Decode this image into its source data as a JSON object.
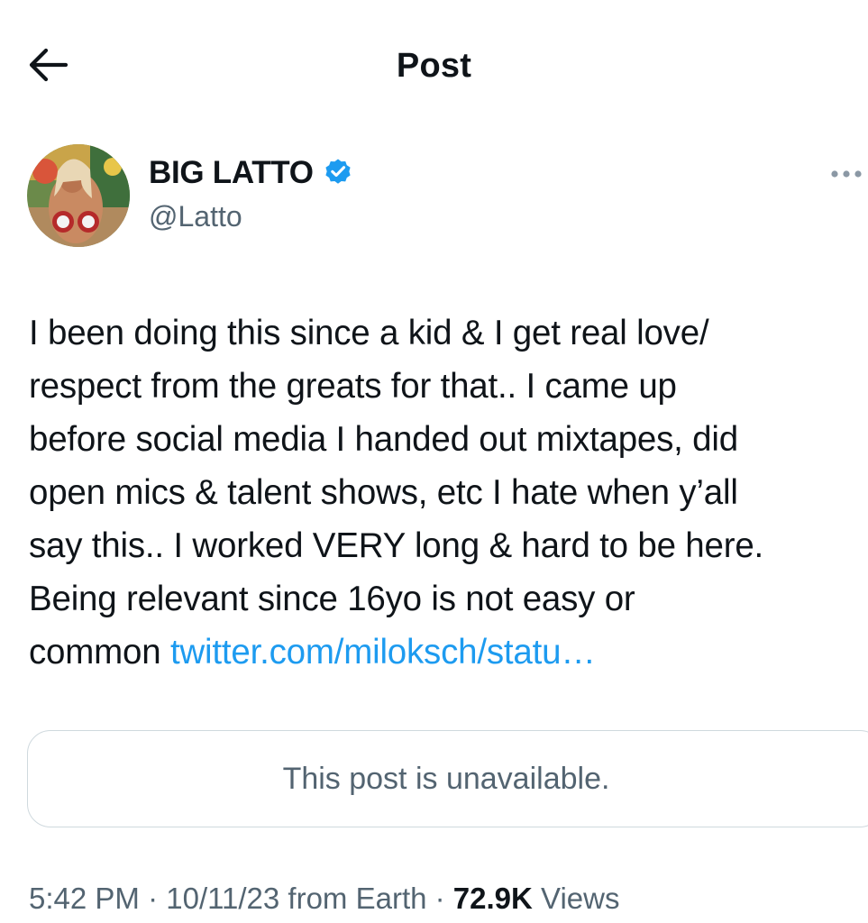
{
  "header": {
    "title": "Post",
    "back_icon": "arrow-left-icon"
  },
  "author": {
    "display_name": "BIG LATTO",
    "handle": "@Latto",
    "verified_icon": "verified-badge-icon",
    "verified_color": "#1d9bf0",
    "more_icon": "more-horizontal-icon"
  },
  "post": {
    "text": "I been doing this since a kid & I get real love/\nrespect from the greats for that.. I came up\nbefore social media I handed out mixtapes, did\nopen mics & talent shows, etc I hate when y’all\nsay this.. I worked VERY long & hard to be here.\nBeing relevant since 16yo is not easy or\ncommon ",
    "link": "twitter.com/miloksch/statu…",
    "link_color": "#1d9bf0"
  },
  "quote": {
    "text": "This post is unavailable."
  },
  "meta": {
    "time": "5:42 PM",
    "sep1": " · ",
    "date": "10/11/23",
    "source": " from Earth",
    "sep2": " · ",
    "views_count": "72.9K",
    "views_label": " Views"
  }
}
